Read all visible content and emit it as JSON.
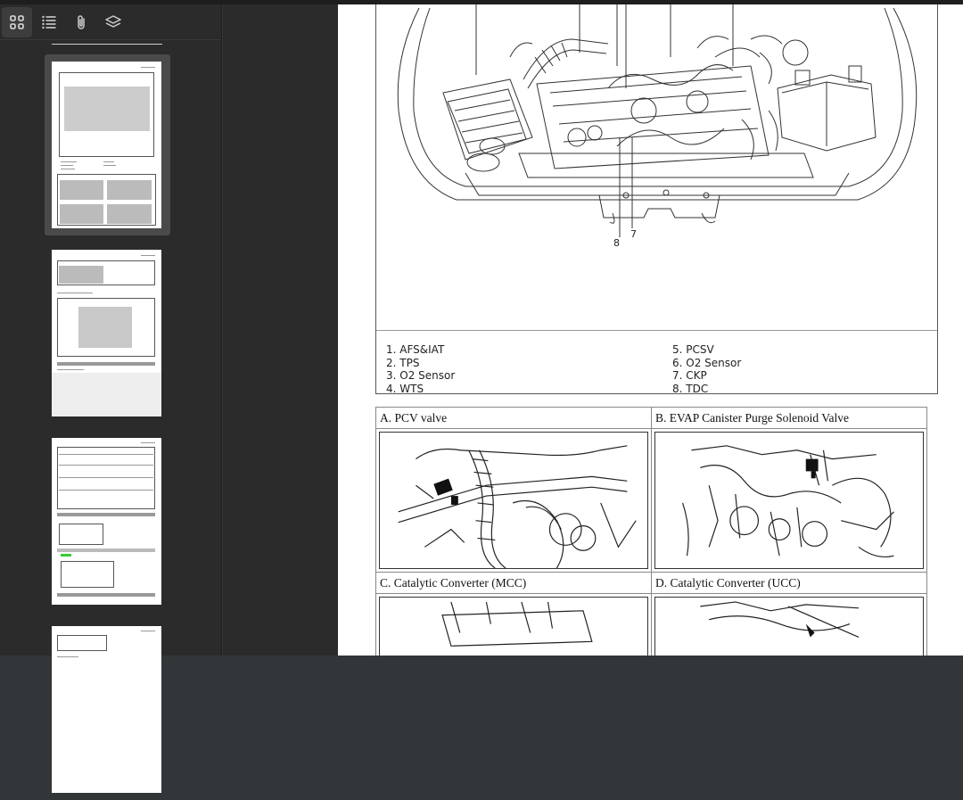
{
  "toolbar": {
    "icons": [
      "thumbnails-icon",
      "outline-icon",
      "attachments-icon",
      "layers-icon"
    ]
  },
  "diagram": {
    "callouts": [
      "8",
      "7"
    ],
    "legend_left": [
      "1. AFS&IAT",
      "2. TPS",
      "3. O2 Sensor",
      "4. WTS"
    ],
    "legend_right": [
      "5. PCSV",
      "6. O2 Sensor",
      "7. CKP",
      "8. TDC"
    ]
  },
  "components": {
    "a_label": "A. PCV valve",
    "b_label": "B. EVAP Canister Purge Solenoid Valve",
    "c_label": "C. Catalytic Converter (MCC)",
    "d_label": "D. Catalytic Converter (UCC)"
  },
  "colors": {
    "sidebar_bg": "#2b2b2b",
    "viewer_bg": "#323639",
    "selected_thumb": "#4a4a4a"
  }
}
